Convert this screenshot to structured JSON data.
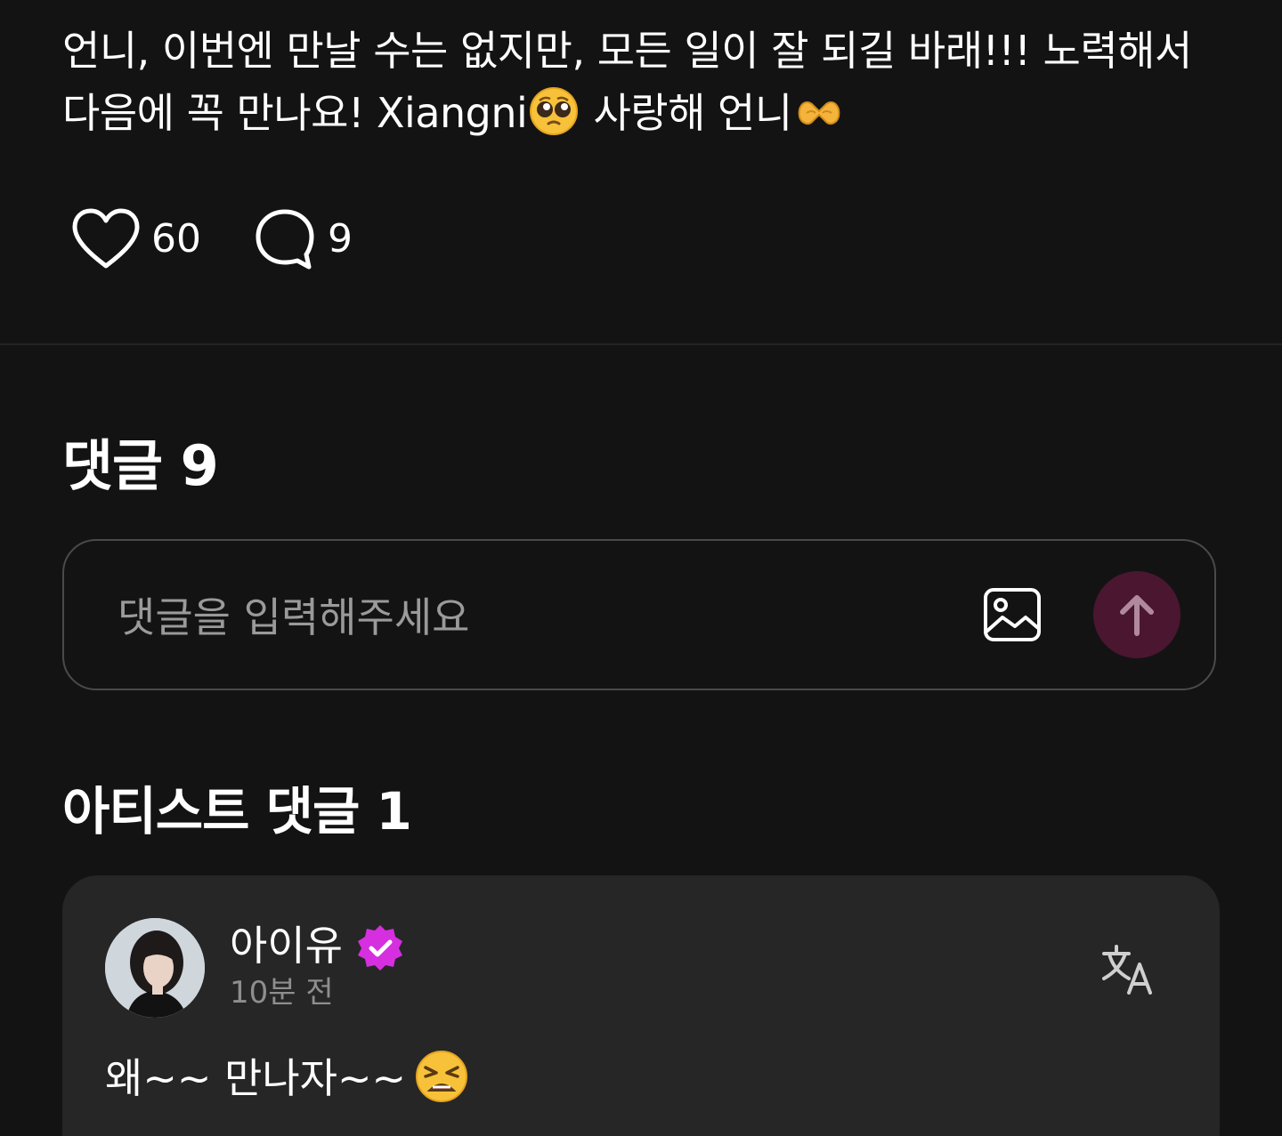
{
  "post": {
    "text_part1": "언니, 이번엔 만날 수는 없지만, 모든 일이 잘 되길 바래!!! 노력해서 다음에 꼭 만나요! Xiangni",
    "text_part2": " 사랑해 언니",
    "emoji_1": "pleading-face-emoji",
    "emoji_2": "heart-hands-emoji"
  },
  "reactions": {
    "likes_count": "60",
    "comments_count": "9"
  },
  "comments_section": {
    "title": "댓글 9",
    "input_placeholder": "댓글을 입력해주세요"
  },
  "artist_comments": {
    "title": "아티스트 댓글 1",
    "items": [
      {
        "author": "아이유",
        "time": "10분 전",
        "text": "왜~~ 만나자~~",
        "emoji": "tired-face-emoji"
      }
    ]
  },
  "colors": {
    "background": "#131313",
    "card": "#262626",
    "send_button": "#4a1630",
    "verified_badge": "#d62fe0"
  }
}
